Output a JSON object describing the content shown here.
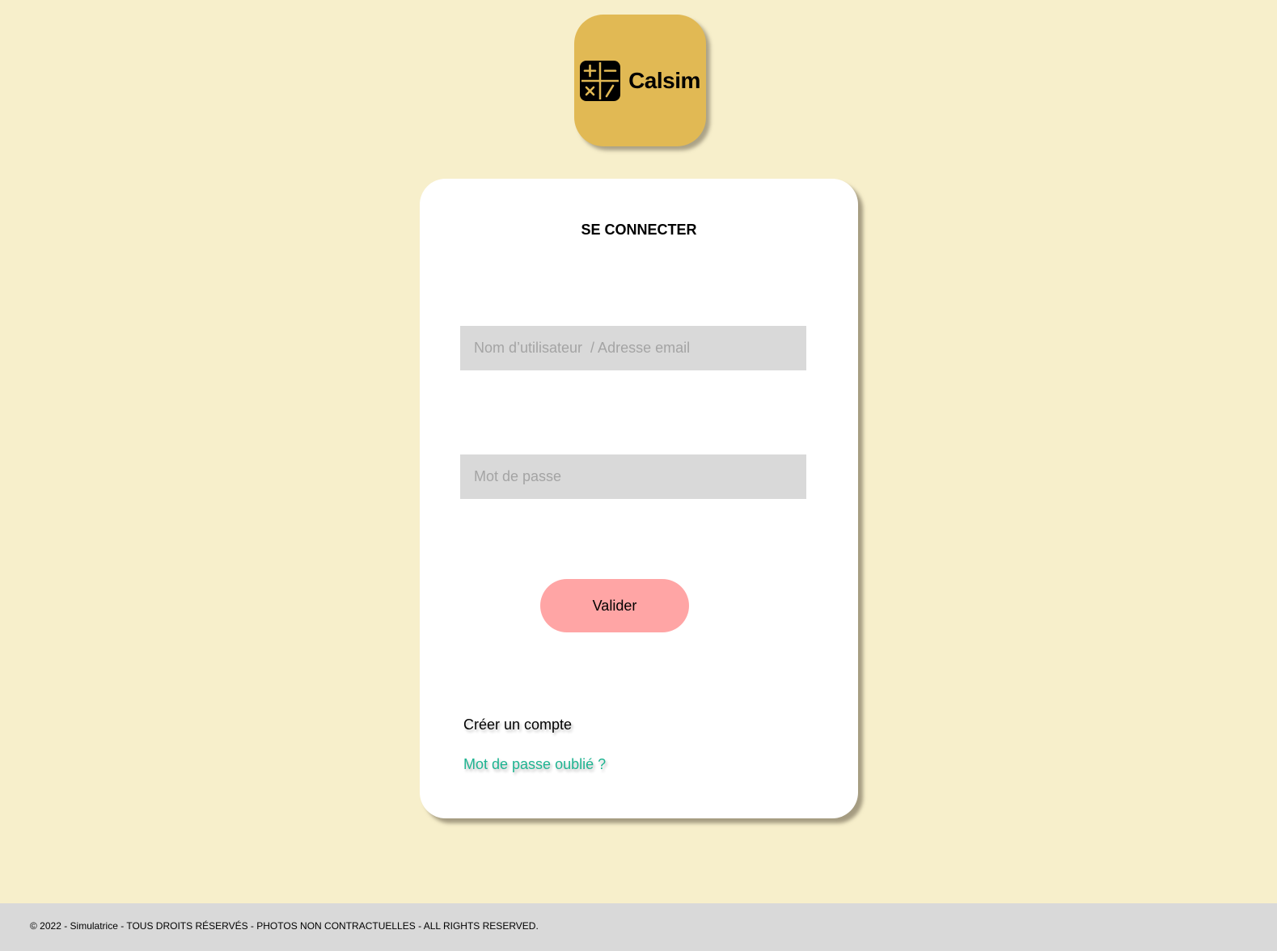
{
  "app": {
    "logo_text": "Calsim",
    "logo_icon": "calculator-operators-icon"
  },
  "login": {
    "title": "SE CONNECTER",
    "username_placeholder": "Nom d’utilisateur  / Adresse email",
    "username_value": "",
    "password_placeholder": "Mot de passe",
    "password_value": "",
    "submit_label": "Valider",
    "create_account_label": "Créer un compte",
    "forgot_password_label": "Mot de passe oublié ?"
  },
  "footer": {
    "text": "© 2022 - Simulatrice - TOUS DROITS RÉSERVÉS - PHOTOS NON CONTRACTUELLES - ALL RIGHTS RESERVED."
  },
  "colors": {
    "page_background": "#f7efcb",
    "logo_background": "#e1b954",
    "card_background": "#ffffff",
    "field_background": "#d9d9d9",
    "button_background": "#ffa5a5",
    "forgot_link": "#1fb491",
    "footer_background": "#d9d9d9"
  }
}
